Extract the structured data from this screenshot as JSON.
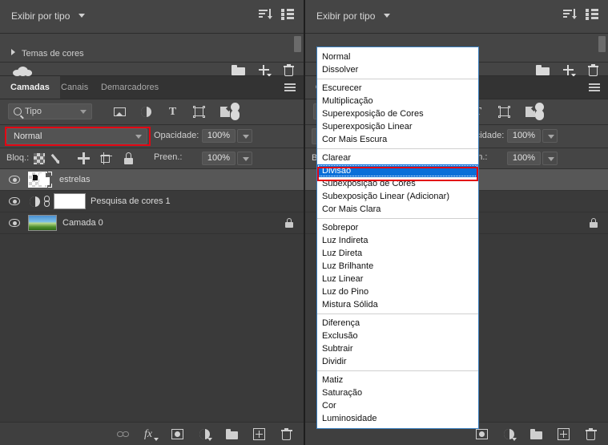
{
  "app": {
    "name": "Adobe Photoshop",
    "panel_title": "Camadas",
    "accent_blue": "#0a6fd8",
    "annotation_red": "#e30613",
    "panel_bg": "#3a3a3a",
    "header_bg": "#454545"
  },
  "topbar": {
    "filter_label": "Exibir por tipo",
    "sort_icon": "sort-icon",
    "list_icon": "list-view-icon"
  },
  "libraries": {
    "group_label": "Temas de cores",
    "expand_icon": "chevron-right-icon",
    "cloud_icon": "cloud-icon",
    "new_group_icon": "new-group-icon",
    "add_icon": "add-icon",
    "delete_icon": "delete-icon"
  },
  "tabs": [
    {
      "label": "Camadas",
      "active": true
    },
    {
      "label": "Canais",
      "active": false
    },
    {
      "label": "Demarcadores",
      "active": false
    }
  ],
  "panel_menu_icon": "panel-menu-icon",
  "filter": {
    "kind_label": "Tipo",
    "search_icon": "search-icon",
    "chevron_icon": "chevron-down-icon",
    "icons": [
      "filter-pixel-icon",
      "filter-adjustment-icon",
      "filter-type-icon",
      "filter-shape-icon",
      "filter-smartobject-icon"
    ],
    "toggle_icon": "filter-toggle-switch"
  },
  "blend": {
    "mode_value": "Normal",
    "opacity_label": "Opacidade:",
    "opacity_value": "100%",
    "highlighted": true
  },
  "lock": {
    "label": "Bloq.:",
    "icons": [
      "lock-transparency-icon",
      "lock-image-icon",
      "lock-position-icon",
      "lock-artboard-icon",
      "lock-all-icon"
    ],
    "fill_label": "Preen.:",
    "fill_value": "100%"
  },
  "layers": [
    {
      "name": "estrelas",
      "visible": true,
      "selected": true,
      "thumb": "checker-smartobject",
      "locked": false
    },
    {
      "name": "Pesquisa de cores 1",
      "visible": true,
      "selected": false,
      "thumb": "adjustment-mask",
      "locked": false
    },
    {
      "name": "Camada 0",
      "visible": true,
      "selected": false,
      "thumb": "photo",
      "locked": true
    }
  ],
  "bottom_bar": {
    "icons": [
      "link-layers-icon",
      "layer-styles-fx-icon",
      "add-mask-icon",
      "adjustment-layer-icon",
      "new-group-icon",
      "new-layer-icon",
      "delete-layer-icon"
    ]
  },
  "bottom_bar_right": {
    "icons": [
      "add-mask-icon",
      "adjustment-layer-icon",
      "new-group-icon",
      "new-layer-icon",
      "delete-layer-icon"
    ]
  },
  "blend_mode_menu": {
    "selected": "Divisão",
    "groups": [
      [
        "Normal",
        "Dissolver"
      ],
      [
        "Escurecer",
        "Multiplicação",
        "Superexposição de Cores",
        "Superexposição Linear",
        "Cor Mais Escura"
      ],
      [
        "Clarear",
        "Divisão",
        "Subexposição de Cores",
        "Subexposição Linear (Adicionar)",
        "Cor Mais Clara"
      ],
      [
        "Sobrepor",
        "Luz Indireta",
        "Luz Direta",
        "Luz Brilhante",
        "Luz Linear",
        "Luz do Pino",
        "Mistura Sólida"
      ],
      [
        "Diferença",
        "Exclusão",
        "Subtrair",
        "Dividir"
      ],
      [
        "Matiz",
        "Saturação",
        "Cor",
        "Luminosidade"
      ]
    ]
  }
}
